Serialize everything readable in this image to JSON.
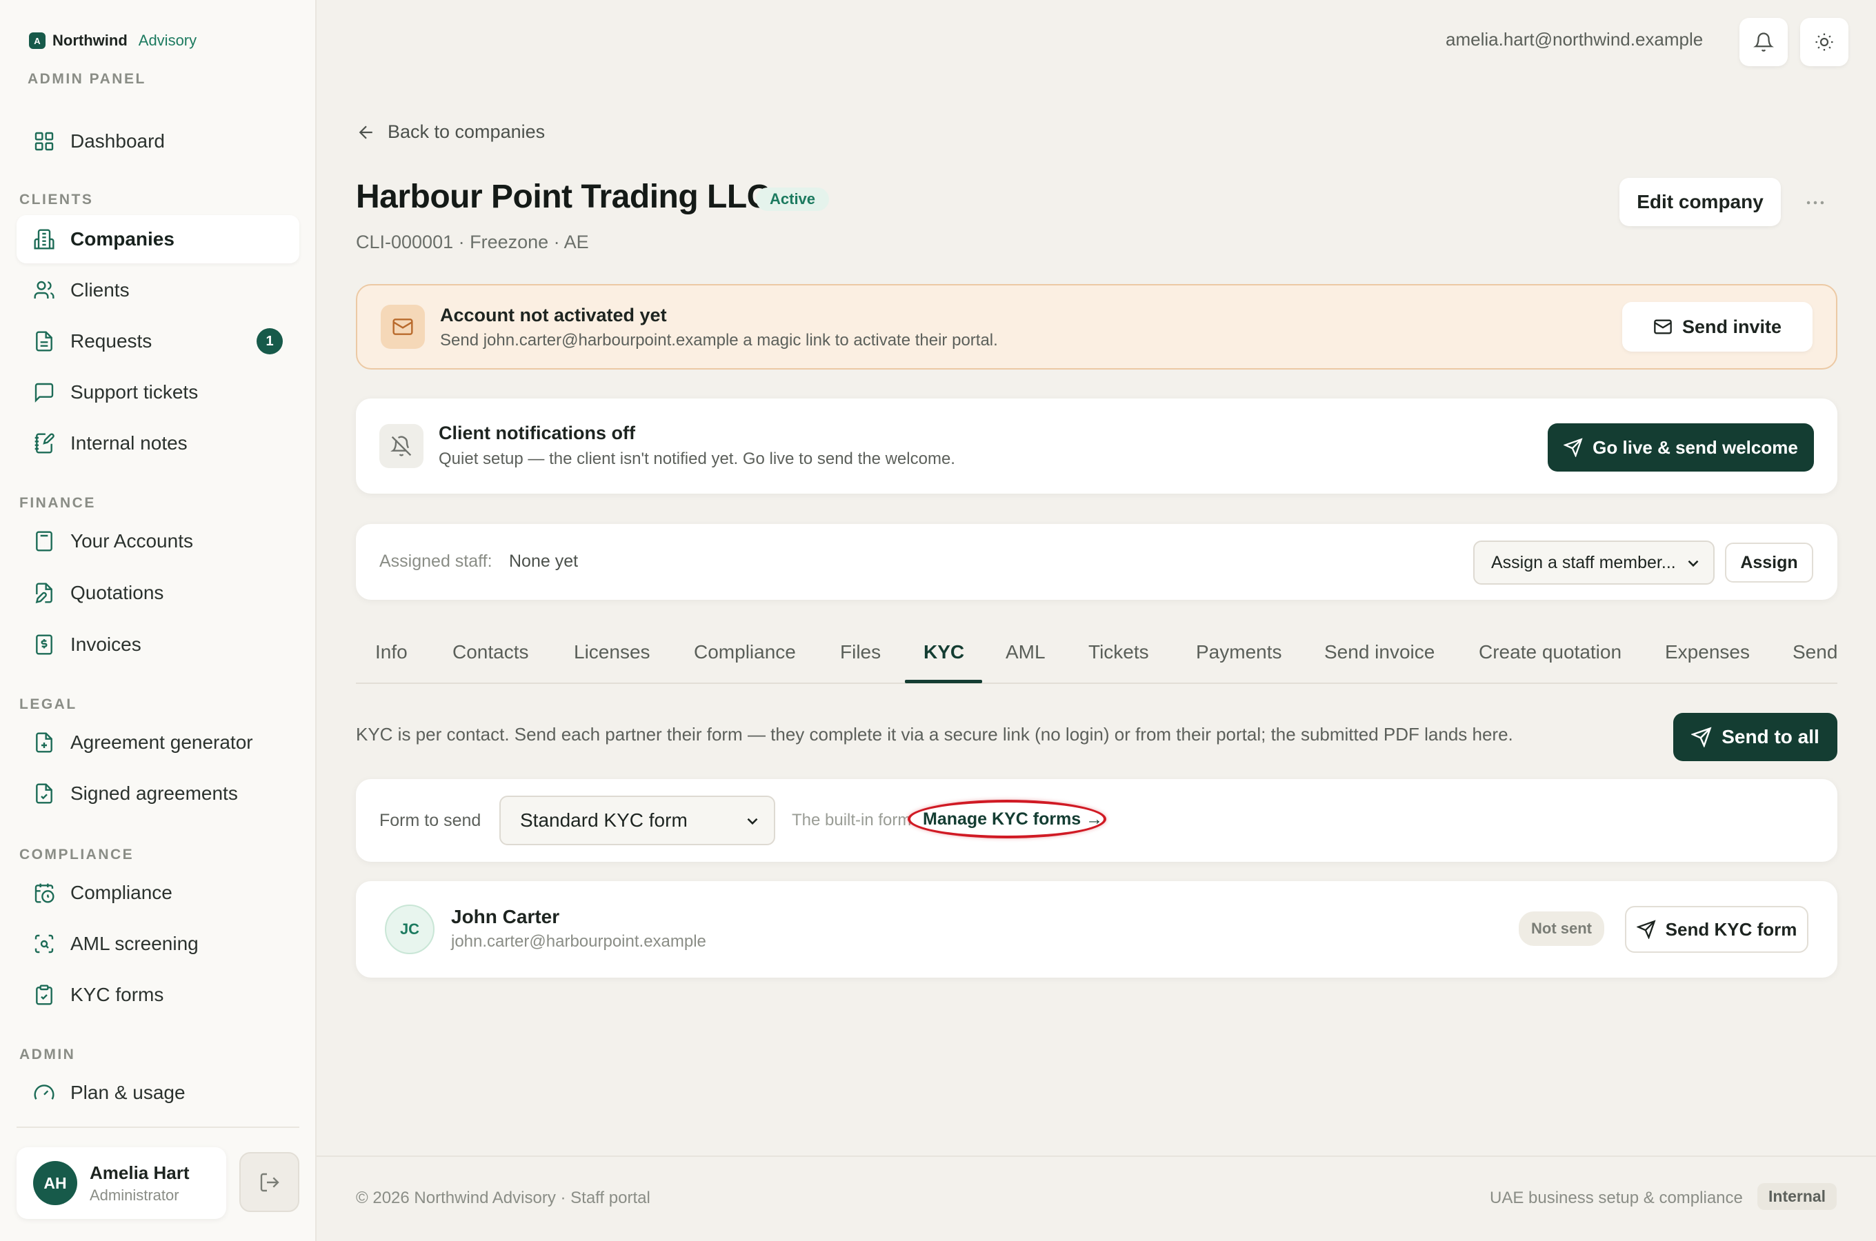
{
  "brand": {
    "logo_letter": "A",
    "name": "Northwind",
    "sub": "Advisory",
    "panel_label": "ADMIN PANEL"
  },
  "sidebar": {
    "items": [
      {
        "label": "Dashboard",
        "icon": "grid-icon"
      },
      {
        "label": "Companies",
        "icon": "building-icon",
        "active": true
      },
      {
        "label": "Clients",
        "icon": "users-icon"
      },
      {
        "label": "Requests",
        "icon": "document-icon",
        "badge": "1"
      },
      {
        "label": "Support tickets",
        "icon": "message-icon"
      },
      {
        "label": "Internal notes",
        "icon": "note-icon"
      },
      {
        "label": "Your Accounts",
        "icon": "calculator-icon"
      },
      {
        "label": "Quotations",
        "icon": "file-edit-icon"
      },
      {
        "label": "Invoices",
        "icon": "receipt-icon"
      },
      {
        "label": "Agreement generator",
        "icon": "file-plus-icon"
      },
      {
        "label": "Signed agreements",
        "icon": "file-check-icon"
      },
      {
        "label": "Compliance",
        "icon": "calendar-clock-icon"
      },
      {
        "label": "AML screening",
        "icon": "scan-icon"
      },
      {
        "label": "KYC forms",
        "icon": "clipboard-icon"
      },
      {
        "label": "Plan & usage",
        "icon": "gauge-icon"
      }
    ],
    "sections": {
      "clients": "CLIENTS",
      "finance": "FINANCE",
      "legal": "LEGAL",
      "compliance": "COMPLIANCE",
      "admin": "ADMIN"
    },
    "user": {
      "initials": "AH",
      "name": "Amelia Hart",
      "role": "Administrator"
    }
  },
  "topbar": {
    "email": "amelia.hart@northwind.example"
  },
  "company": {
    "back_label": "Back to companies",
    "title": "Harbour Point Trading LLC",
    "status": "Active",
    "meta": "CLI-000001 · Freezone · AE",
    "edit_label": "Edit company"
  },
  "banners": {
    "activation": {
      "title": "Account not activated yet",
      "desc": "Send john.carter@harbourpoint.example a magic link to activate their portal.",
      "button": "Send invite"
    },
    "notifications": {
      "title": "Client notifications off",
      "desc": "Quiet setup — the client isn't notified yet. Go live to send the welcome.",
      "button": "Go live & send welcome"
    }
  },
  "staff": {
    "label": "Assigned staff:",
    "value": "None yet",
    "select_value": "Assign a staff member...",
    "assign_label": "Assign"
  },
  "tabs": [
    {
      "label": "Info"
    },
    {
      "label": "Contacts"
    },
    {
      "label": "Licenses"
    },
    {
      "label": "Compliance"
    },
    {
      "label": "Files"
    },
    {
      "label": "KYC",
      "active": true
    },
    {
      "label": "AML"
    },
    {
      "label": "Tickets"
    },
    {
      "label": "Payments"
    },
    {
      "label": "Send invoice"
    },
    {
      "label": "Create quotation"
    },
    {
      "label": "Expenses"
    },
    {
      "label": "Send"
    }
  ],
  "kyc": {
    "description": "KYC is per contact. Send each partner their form — they complete it via a secure link (no login) or from their portal; the submitted PDF lands here.",
    "send_all_label": "Send to all",
    "form_label": "Form to send",
    "form_value": "Standard KYC form",
    "form_hint": "The built-in form",
    "manage_link": "Manage KYC forms →"
  },
  "contacts": [
    {
      "initials": "JC",
      "name": "John Carter",
      "email": "john.carter@harbourpoint.example",
      "status": "Not sent",
      "action": "Send KYC form"
    }
  ],
  "footer": {
    "left": "© 2026 Northwind Advisory · Staff portal",
    "right": "UAE business setup & compliance",
    "pill": "Internal"
  },
  "colors": {
    "brand": "#175a4a",
    "primary_button": "#143d32",
    "accent": "#1c7a5f",
    "highlight_ring": "#d01a24",
    "warning_bg": "#fbefe2"
  }
}
